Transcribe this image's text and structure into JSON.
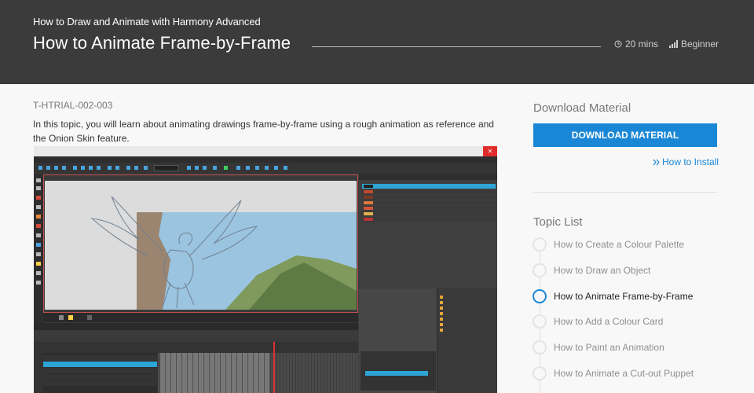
{
  "header": {
    "course_title": "How to Draw and Animate with Harmony Advanced",
    "page_title": "How to Animate Frame-by-Frame",
    "duration": "20 mins",
    "level": "Beginner"
  },
  "main": {
    "topic_code": "T-HTRIAL-002-003",
    "intro": "In this topic, you will learn about animating drawings frame-by-frame using a rough animation as reference and the Onion Skin feature."
  },
  "sidebar": {
    "download_heading": "Download Material",
    "download_button": "DOWNLOAD MATERIAL",
    "install_link": "How to Install",
    "topic_list_heading": "Topic List",
    "topics": [
      {
        "label": "How to Create a Colour Palette",
        "active": false
      },
      {
        "label": "How to Draw an Object",
        "active": false
      },
      {
        "label": "How to Animate Frame-by-Frame",
        "active": true
      },
      {
        "label": "How to Add a Colour Card",
        "active": false
      },
      {
        "label": "How to Paint an Animation",
        "active": false
      },
      {
        "label": "How to Animate a Cut-out Puppet",
        "active": false
      }
    ]
  },
  "colors": {
    "header_bg": "#3b3b3b",
    "accent": "#1a87d6",
    "selection": "#2ca5d6",
    "page_bg": "#f8f8f8"
  },
  "icons": {
    "duration": "clock-icon",
    "level": "signal-bars-icon",
    "install": "double-chevron-right-icon",
    "topic_marker": "circle-icon"
  }
}
